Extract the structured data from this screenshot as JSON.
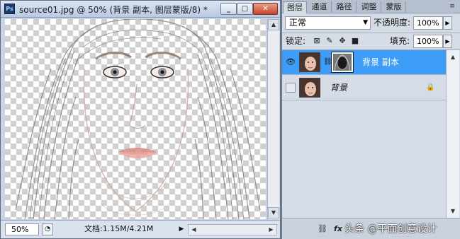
{
  "document": {
    "app_icon_text": "Ps",
    "title": "source01.jpg @ 50% (背景 副本, 图层蒙版/8) *",
    "controls": {
      "minimize": "_",
      "maximize": "□",
      "close": "✕"
    },
    "zoom": "50%",
    "doc_info": "文档:1.15M/4.21M",
    "arrow_right": "▶",
    "scroll_up": "▲",
    "scroll_down": "▼",
    "scroll_left": "◀",
    "scroll_right": "▶"
  },
  "panel": {
    "tabs": [
      {
        "label": "图层",
        "active": true
      },
      {
        "label": "通道",
        "active": false
      },
      {
        "label": "路径",
        "active": false
      },
      {
        "label": "调整",
        "active": false
      },
      {
        "label": "蒙版",
        "active": false
      }
    ],
    "menu": "≡",
    "blend_mode": "正常",
    "opacity_label": "不透明度:",
    "opacity_value": "100%",
    "lock_label": "锁定:",
    "fill_label": "填充:",
    "fill_value": "100%",
    "layers": [
      {
        "name": "背景 副本",
        "visible": true,
        "selected": true,
        "has_mask": true
      },
      {
        "name": "背景",
        "visible": false,
        "selected": false,
        "locked": true
      }
    ],
    "bottom_icons": [
      "link-icon",
      "fx-icon"
    ],
    "fx_label": "fx",
    "watermark": "头条 @平面创意设计"
  },
  "colors": {
    "selected_layer": "#3e9df7",
    "close_button": "#c7432a"
  }
}
